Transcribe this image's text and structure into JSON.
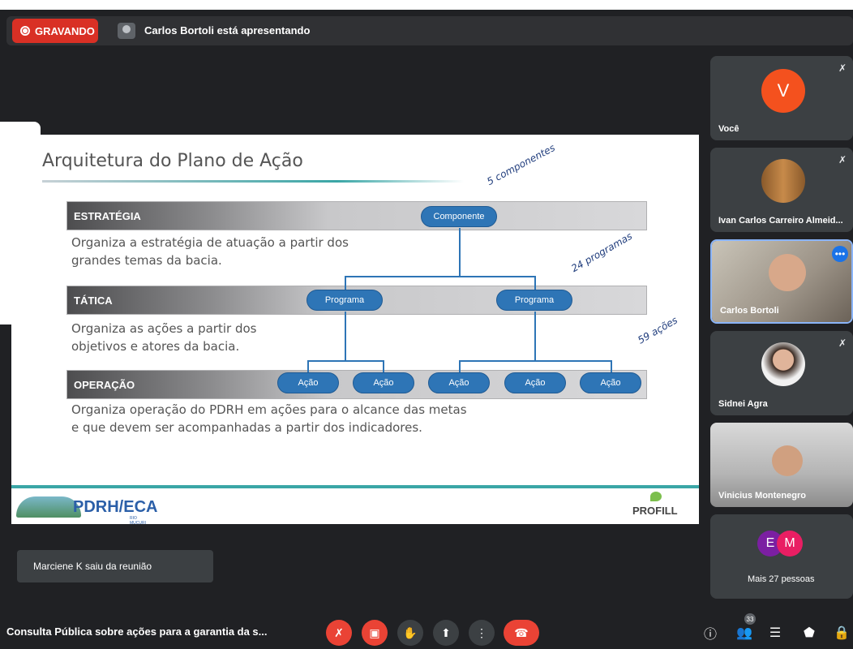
{
  "topbar": {
    "recording_label": "GRAVANDO",
    "presenter_text": "Carlos Bortoli está apresentando"
  },
  "slide": {
    "title": "Arquitetura do Plano de Ação",
    "levels": [
      {
        "label": "ESTRATÉGIA",
        "desc_line1": "Organiza a estratégia de atuação a partir dos",
        "desc_line2": "grandes temas da bacia."
      },
      {
        "label": "TÁTICA",
        "desc_line1": "Organiza as ações a partir dos",
        "desc_line2": "objetivos e atores da bacia."
      },
      {
        "label": "OPERAÇÃO",
        "desc_line1": "Organiza operação do PDRH em ações para o alcance das metas",
        "desc_line2": "e que devem ser acompanhadas a partir dos indicadores."
      }
    ],
    "componente_label": "Componente",
    "programa_labels": [
      "Programa",
      "Programa"
    ],
    "acao_labels": [
      "Ação",
      "Ação",
      "Ação",
      "Ação",
      "Ação"
    ],
    "annotations": [
      "5 componentes",
      "24 programas",
      "59 ações"
    ],
    "logo_left": "PDRH/ECA",
    "logo_left_small": "RIO MUCURI",
    "logo_right": "PROFILL"
  },
  "participants": [
    {
      "name": "Você",
      "initial": "V",
      "color": "#f4511e"
    },
    {
      "name": "Ivan Carlos Carreiro Almeid..."
    },
    {
      "name": "Carlos Bortoli"
    },
    {
      "name": "Sidnei Agra"
    },
    {
      "name": "Vinicius Montenegro"
    },
    {
      "name": "Mais 27 pessoas",
      "initials": [
        "E",
        "M"
      ]
    }
  ],
  "toast": "Marciene K saiu da reunião",
  "bottombar": {
    "meeting_title": "Consulta Pública sobre ações para a garantia da s...",
    "people_count": "33"
  }
}
